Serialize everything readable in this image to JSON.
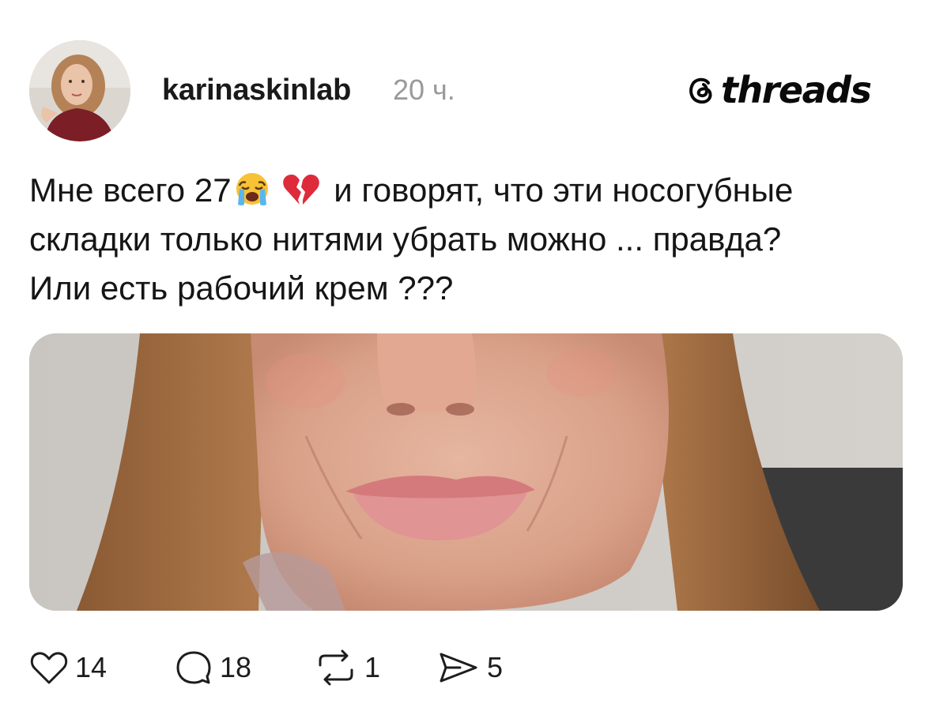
{
  "post": {
    "username": "karinaskinlab",
    "timestamp": "20 ч.",
    "text_line1_start": "Мне всего 27",
    "text_line1_end": " и говорят, что эти носогубные",
    "text_line2": "складки только нитями убрать можно ... правда?",
    "text_line3": "Или есть рабочий крем ???",
    "emojis": [
      "loudly-crying-face",
      "broken-heart"
    ]
  },
  "brand": {
    "name": "threads",
    "icon": "threads-logo-icon"
  },
  "actions": {
    "likes": "14",
    "replies": "18",
    "reposts": "1",
    "shares": "5"
  },
  "colors": {
    "text": "#151515",
    "muted": "#9a9a9a",
    "background": "#ffffff"
  }
}
